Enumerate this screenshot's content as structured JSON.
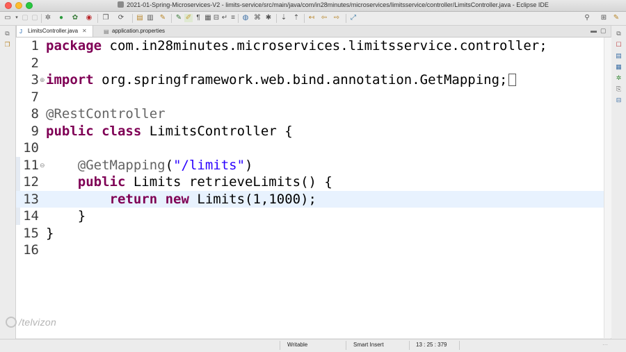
{
  "window": {
    "title": "2021-01-Spring-Microservices-V2 - limits-service/src/main/java/com/in28minutes/microservices/limitsservice/controller/LimitsController.java - Eclipse IDE"
  },
  "tabs": [
    {
      "label": "LimitsController.java",
      "active": true
    },
    {
      "label": "application.properties",
      "active": false
    }
  ],
  "editor": {
    "lines": [
      {
        "num": "1",
        "tokens": [
          {
            "t": "package",
            "c": "kw"
          },
          {
            "t": " com.in28minutes.microservices.limitsservice.controller;",
            "c": ""
          }
        ]
      },
      {
        "num": "2",
        "tokens": []
      },
      {
        "num": "3",
        "fold": "⊕",
        "tokens": [
          {
            "t": "import",
            "c": "kw"
          },
          {
            "t": " org.springframework.web.bind.annotation.GetMapping;",
            "c": ""
          }
        ],
        "caret_box": true
      },
      {
        "num": "7",
        "tokens": []
      },
      {
        "num": "8",
        "tokens": [
          {
            "t": "@RestController",
            "c": "ann"
          }
        ]
      },
      {
        "num": "9",
        "tokens": [
          {
            "t": "public",
            "c": "kw"
          },
          {
            "t": " ",
            "c": ""
          },
          {
            "t": "class",
            "c": "kw"
          },
          {
            "t": " LimitsController {",
            "c": ""
          }
        ]
      },
      {
        "num": "10",
        "tokens": []
      },
      {
        "num": "11",
        "fold": "⊖",
        "tokens": [
          {
            "t": "    ",
            "c": ""
          },
          {
            "t": "@GetMapping",
            "c": "ann"
          },
          {
            "t": "(",
            "c": ""
          },
          {
            "t": "\"/limits\"",
            "c": "str"
          },
          {
            "t": ")",
            "c": ""
          }
        ]
      },
      {
        "num": "12",
        "tokens": [
          {
            "t": "    ",
            "c": ""
          },
          {
            "t": "public",
            "c": "kw"
          },
          {
            "t": " Limits retrieveLimits() {",
            "c": ""
          }
        ]
      },
      {
        "num": "13",
        "highlight": true,
        "tokens": [
          {
            "t": "        ",
            "c": ""
          },
          {
            "t": "return",
            "c": "kw"
          },
          {
            "t": " ",
            "c": ""
          },
          {
            "t": "new",
            "c": "kw"
          },
          {
            "t": " Limits(1,1000);",
            "c": ""
          }
        ]
      },
      {
        "num": "14",
        "tokens": [
          {
            "t": "    }",
            "c": ""
          }
        ]
      },
      {
        "num": "15",
        "tokens": [
          {
            "t": "}",
            "c": ""
          }
        ]
      },
      {
        "num": "16",
        "tokens": []
      }
    ]
  },
  "status": {
    "mode": "Writable",
    "insert": "Smart Insert",
    "position": "13 : 25 : 379"
  },
  "watermark": "/telvizon",
  "colors": {
    "keyword": "#7f0055",
    "annotation": "#646464",
    "string": "#2a00ff",
    "current_line": "#e8f2fe"
  }
}
